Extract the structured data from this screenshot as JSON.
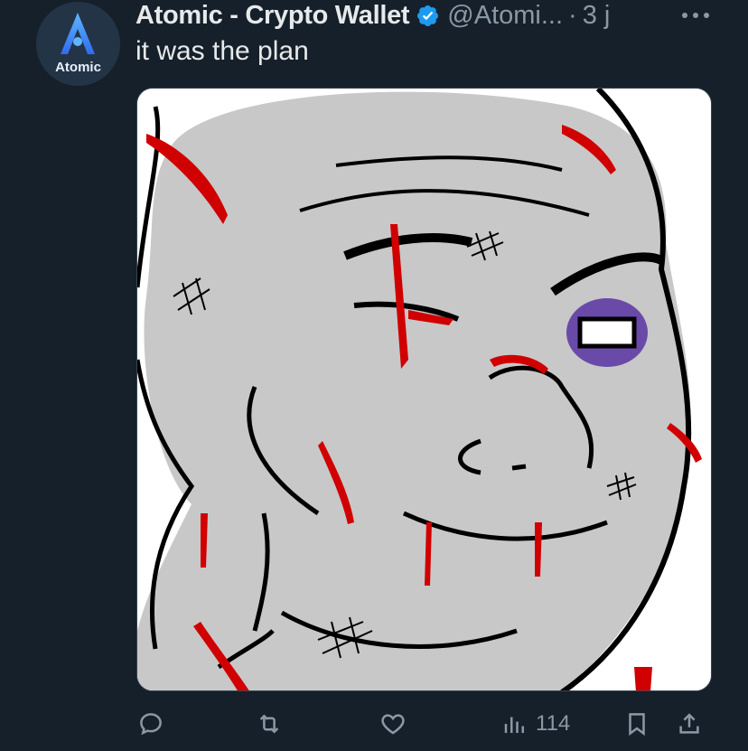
{
  "account": {
    "avatar_text": "Atomic",
    "display_name": "Atomic - Crypto Wallet",
    "handle": "@Atomi...",
    "separator": "·",
    "time": "3 j"
  },
  "tweet": {
    "text": "it was the plan"
  },
  "actions": {
    "views": "114"
  },
  "icons": {
    "verified": "verified-badge-icon",
    "more": "more-icon",
    "reply": "reply-icon",
    "retweet": "retweet-icon",
    "like": "heart-icon",
    "views": "views-icon",
    "bookmark": "bookmark-icon",
    "share": "share-icon"
  },
  "colors": {
    "background": "#15202b",
    "text": "#e7e9ea",
    "secondary_text": "#8b98a5",
    "verified": "#1d9bf0",
    "avatar_accent": "#3b7cf6"
  }
}
